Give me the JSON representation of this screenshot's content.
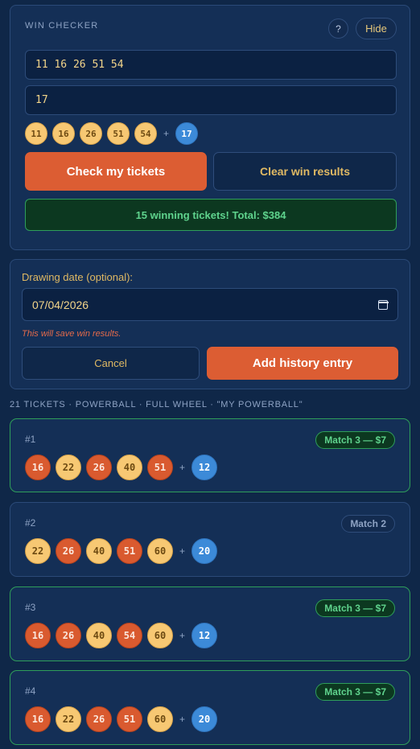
{
  "win_checker": {
    "title": "WIN CHECKER",
    "help_label": "?",
    "hide_label": "Hide",
    "main_numbers_value": "11 16 26 51 54",
    "powerball_value": "17",
    "preview_main": [
      "11",
      "16",
      "26",
      "51",
      "54"
    ],
    "preview_plus": "+",
    "preview_powerball": "17",
    "check_label": "Check my tickets",
    "clear_label": "Clear win results",
    "result_text": "15 winning tickets! Total: $384"
  },
  "history": {
    "date_label": "Drawing date (optional):",
    "date_value": "07/04/2026",
    "warning": "This will save win results.",
    "cancel_label": "Cancel",
    "add_label": "Add history entry"
  },
  "tickets_meta": "21 TICKETS · POWERBALL · FULL WHEEL · \"MY POWERBALL\"",
  "tickets": [
    {
      "number": "#1",
      "badge": "Match 3 — $7",
      "winner": true,
      "balls": [
        {
          "v": "16",
          "hit": true
        },
        {
          "v": "22",
          "hit": false
        },
        {
          "v": "26",
          "hit": true
        },
        {
          "v": "40",
          "hit": false
        },
        {
          "v": "51",
          "hit": true
        }
      ],
      "powerball": "12"
    },
    {
      "number": "#2",
      "badge": "Match 2",
      "winner": false,
      "balls": [
        {
          "v": "22",
          "hit": false
        },
        {
          "v": "26",
          "hit": true
        },
        {
          "v": "40",
          "hit": false
        },
        {
          "v": "51",
          "hit": true
        },
        {
          "v": "60",
          "hit": false
        }
      ],
      "powerball": "20"
    },
    {
      "number": "#3",
      "badge": "Match 3 — $7",
      "winner": true,
      "balls": [
        {
          "v": "16",
          "hit": true
        },
        {
          "v": "26",
          "hit": true
        },
        {
          "v": "40",
          "hit": false
        },
        {
          "v": "54",
          "hit": true
        },
        {
          "v": "60",
          "hit": false
        }
      ],
      "powerball": "12"
    },
    {
      "number": "#4",
      "badge": "Match 3 — $7",
      "winner": true,
      "balls": [
        {
          "v": "16",
          "hit": true
        },
        {
          "v": "22",
          "hit": false
        },
        {
          "v": "26",
          "hit": true
        },
        {
          "v": "51",
          "hit": true
        },
        {
          "v": "60",
          "hit": false
        }
      ],
      "powerball": "20"
    }
  ],
  "plus_sign": "+"
}
